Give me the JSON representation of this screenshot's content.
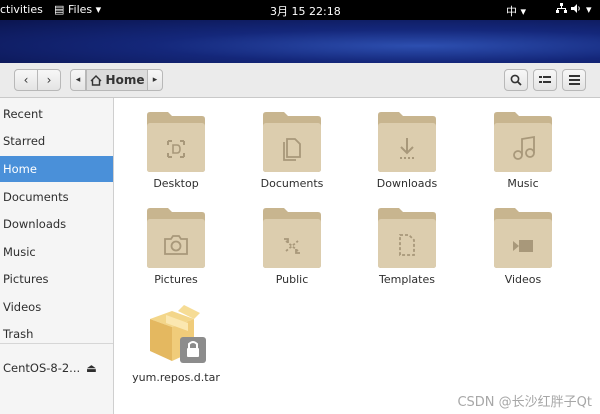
{
  "topbar": {
    "activities": "ctivities",
    "app_menu": "Files ▾",
    "clock": "3月 15  22:18",
    "input_method": "中 ▾",
    "status": "▾"
  },
  "header": {
    "path_home": "Home",
    "back": "‹",
    "forward": "›",
    "path_left": "◂",
    "path_right": "▸"
  },
  "sidebar": {
    "items": [
      {
        "label": "Recent"
      },
      {
        "label": "Starred"
      },
      {
        "label": "Home"
      },
      {
        "label": "Documents"
      },
      {
        "label": "Downloads"
      },
      {
        "label": "Music"
      },
      {
        "label": "Pictures"
      },
      {
        "label": "Videos"
      },
      {
        "label": "Trash"
      },
      {
        "label": "CentOS-8-2..."
      }
    ],
    "eject": "⏏"
  },
  "files": [
    {
      "label": "Desktop",
      "icon": "desktop-icon"
    },
    {
      "label": "Documents",
      "icon": "document-icon"
    },
    {
      "label": "Downloads",
      "icon": "download-icon"
    },
    {
      "label": "Music",
      "icon": "music-icon"
    },
    {
      "label": "Pictures",
      "icon": "camera-icon"
    },
    {
      "label": "Public",
      "icon": "share-icon"
    },
    {
      "label": "Templates",
      "icon": "template-icon"
    },
    {
      "label": "Videos",
      "icon": "video-icon"
    },
    {
      "label": "yum.repos.d.tar",
      "icon": "archive-locked-icon"
    }
  ],
  "watermark": "CSDN @长沙红胖子Qt",
  "colors": {
    "accent": "#4a90d9",
    "folder": "#d9c9a8",
    "folder_tab": "#c8b58f"
  }
}
